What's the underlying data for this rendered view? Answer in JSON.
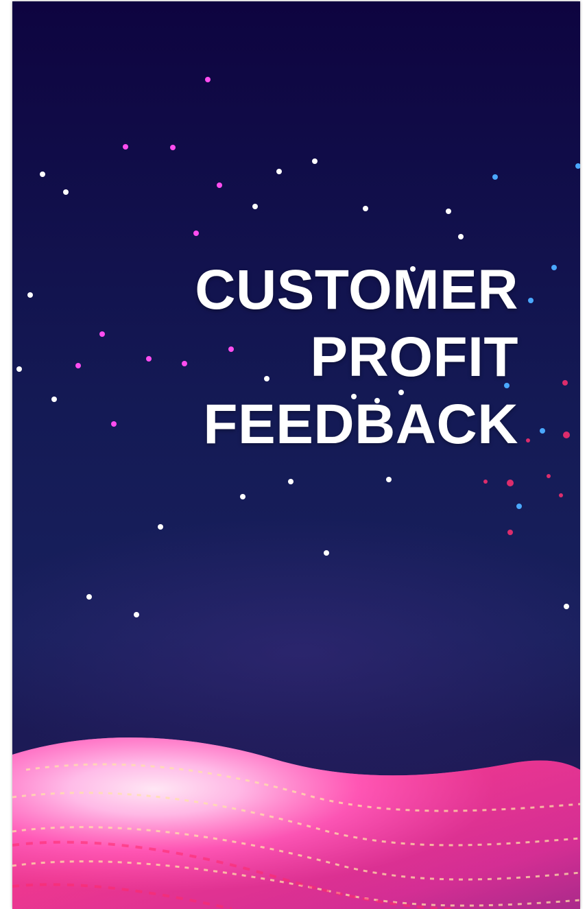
{
  "cover": {
    "title_lines": [
      "CUSTOMER",
      "PROFIT",
      "FEEDBACK"
    ]
  },
  "colors": {
    "background_top": "#0e0440",
    "background_mid": "#18205d",
    "line_white": "#ffffff",
    "line_magenta": "#e03cd6",
    "line_blue": "#3a8cff",
    "wave_pink": "#ff4fb0",
    "wave_glow": "#ffd6f4",
    "title_text": "#ffffff"
  },
  "icons": {
    "background_art": "digital-rain-light-lines",
    "wave": "glowing-pink-particle-wave"
  }
}
